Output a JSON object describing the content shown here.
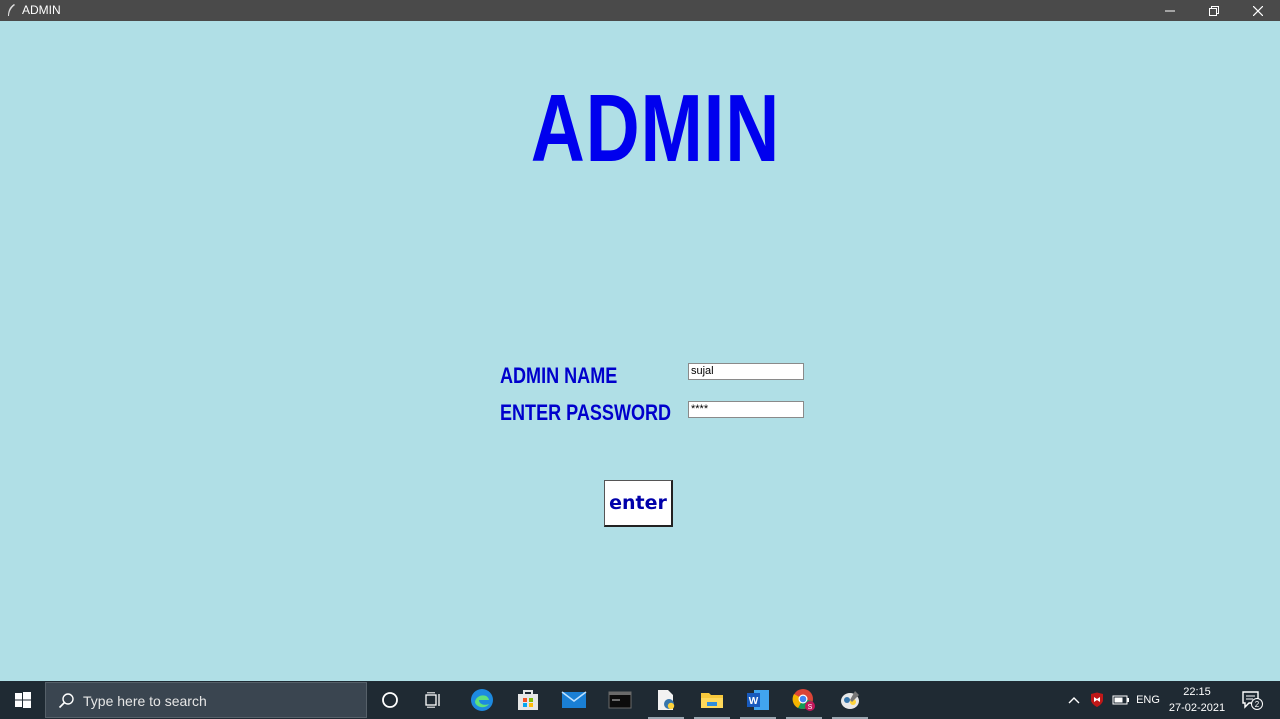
{
  "window": {
    "title": "ADMIN"
  },
  "app": {
    "heading": "ADMIN",
    "admin_name_label": "ADMIN NAME",
    "password_label": "ENTER PASSWORD",
    "admin_name_value": "sujal",
    "password_value": "****",
    "enter_label": "enter"
  },
  "taskbar": {
    "search_placeholder": "Type here to search",
    "language": "ENG",
    "time": "22:15",
    "date": "27-02-2021",
    "notification_count": "2"
  },
  "colors": {
    "background": "#b0dfe6",
    "heading": "#0000ee",
    "label": "#0000cc",
    "button_text": "#0000aa"
  }
}
